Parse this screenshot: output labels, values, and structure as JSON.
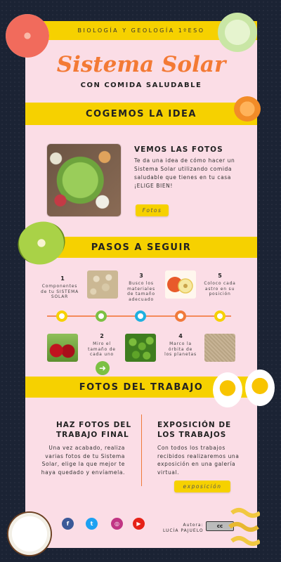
{
  "header": {
    "course": "BIOLOGÍA Y GEOLOGÍA 1ºESO",
    "title": "Sistema Solar",
    "subtitle": "CON COMIDA SALUDABLE"
  },
  "section_idea": {
    "band": "COGEMOS LA IDEA",
    "heading": "VEMOS LAS FOTOS",
    "text": "Te da una idea de cómo hacer un Sistema Solar utilizando comida saludable que tienes en tu casa ¡ELIGE BIEN!",
    "button": "Fotos"
  },
  "section_steps": {
    "band": "PASOS A SEGUIR",
    "steps": [
      {
        "num": "1",
        "text": "Componentes de tu SISTEMA SOLAR"
      },
      {
        "num": "2",
        "text": "Miro el tamaño de cada uno"
      },
      {
        "num": "3",
        "text": "Busco los materiales de tamaño adecuado"
      },
      {
        "num": "4",
        "text": "Marco la órbita de los planetas"
      },
      {
        "num": "5",
        "text": "Coloco cada astro en su posición"
      }
    ],
    "dot_colors": [
      "#f6d100",
      "#7bc043",
      "#1eb0e0",
      "#f07a3a",
      "#f6d100"
    ]
  },
  "section_work": {
    "band": "FOTOS DEL TRABAJO",
    "left": {
      "heading": "HAZ FOTOS DEL TRABAJO FINAL",
      "text": "Una vez acabado, realiza varias fotos de tu Sistema Solar, elige la que mejor te haya quedado y envíamela."
    },
    "right": {
      "heading": "EXPOSICIÓN DE LOS TRABAJOS",
      "text": "Con todos los trabajos recibidos realizaremos una exposición en una galería virtual.",
      "button": "exposición"
    }
  },
  "footer": {
    "social": [
      "facebook-icon",
      "twitter-icon",
      "instagram-icon",
      "youtube-icon"
    ],
    "author_label": "Autora:",
    "author_name": "LUCÍA PAJUELO",
    "license": "cc"
  },
  "colors": {
    "yellow": "#f6d100",
    "pink": "#fbdde6",
    "orange": "#f37a35",
    "background": "#1b2334"
  }
}
